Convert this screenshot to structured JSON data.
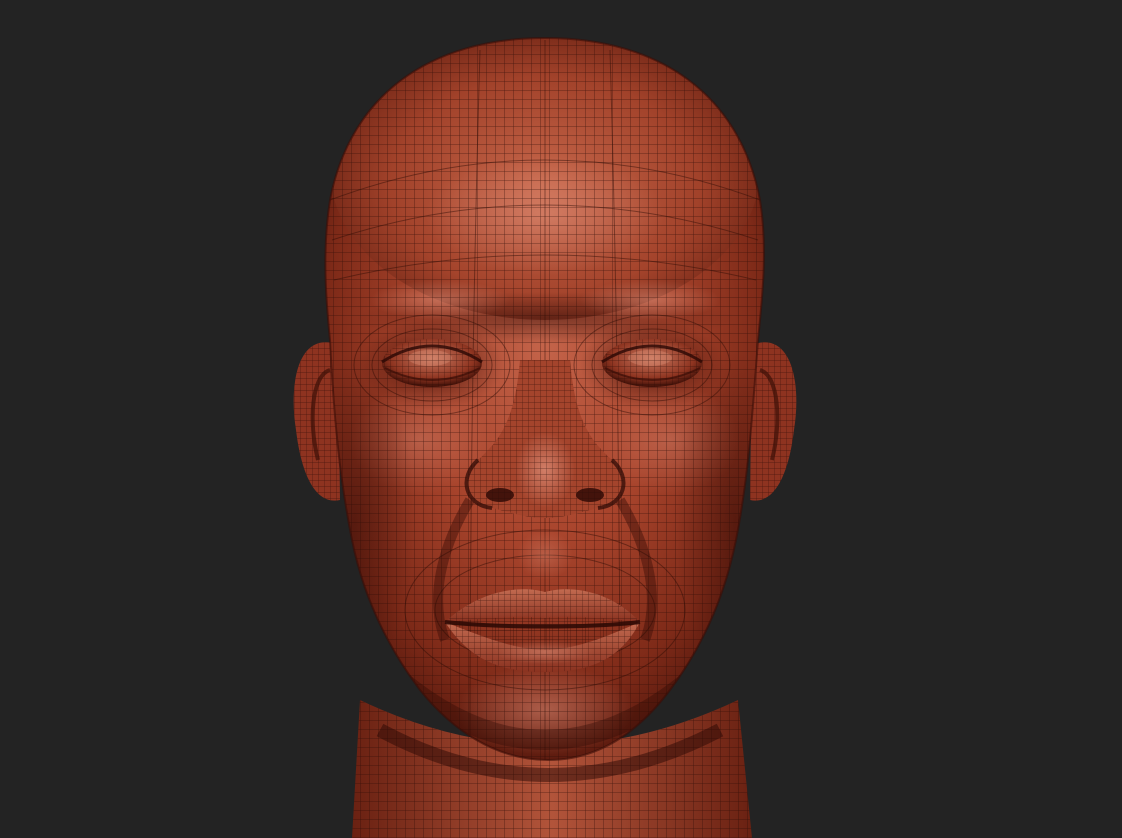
{
  "viewport": {
    "background_color": "#232323"
  },
  "model": {
    "subject": "head",
    "view": "front",
    "display_mode": "wireframe-over-shaded",
    "skin_base_color": "#9c3a25",
    "skin_highlight_color": "#d9836a",
    "skin_shadow_color": "#4a140b",
    "wire_color": "#2a0a05"
  }
}
